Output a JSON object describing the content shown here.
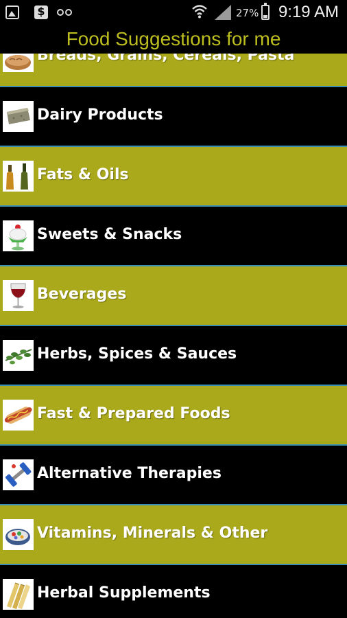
{
  "status_bar": {
    "battery_percent": "27%",
    "battery_level": 0.27,
    "time": "9:19 AM",
    "icons": [
      "gallery-icon",
      "dollar-icon",
      "voicemail-icon",
      "wifi-icon",
      "cell-signal-icon",
      "battery-icon"
    ]
  },
  "header": {
    "title": "Food Suggestions for me",
    "title_color": "#bcbd1f"
  },
  "colors": {
    "row_olive": "#aaa91b",
    "row_black": "#000000",
    "divider": "#3a8fb3",
    "label": "#ffffff"
  },
  "categories": [
    {
      "label": "Breads, Grains, Cereals, Pasta",
      "icon": "bread-icon"
    },
    {
      "label": "Dairy Products",
      "icon": "cheese-icon"
    },
    {
      "label": "Fats & Oils",
      "icon": "oil-bottles-icon"
    },
    {
      "label": "Sweets & Snacks",
      "icon": "sundae-icon"
    },
    {
      "label": "Beverages",
      "icon": "wine-glass-icon"
    },
    {
      "label": "Herbs, Spices & Sauces",
      "icon": "herbs-icon"
    },
    {
      "label": "Fast & Prepared Foods",
      "icon": "hot-dog-icon"
    },
    {
      "label": "Alternative Therapies",
      "icon": "dumbbell-icon"
    },
    {
      "label": "Vitamins, Minerals & Other",
      "icon": "vitamins-bowl-icon"
    },
    {
      "label": "Herbal Supplements",
      "icon": "herbal-roots-icon"
    }
  ]
}
